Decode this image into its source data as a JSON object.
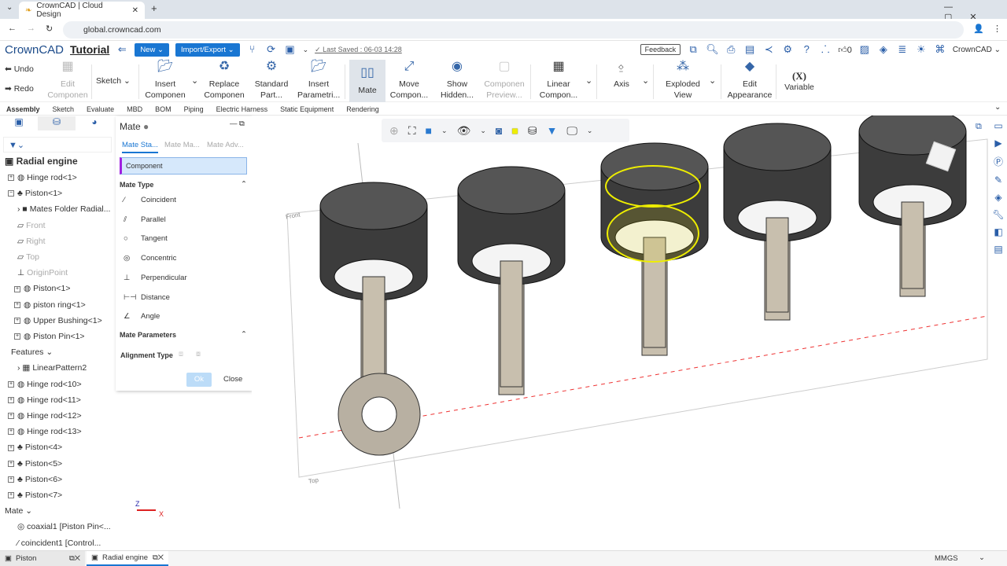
{
  "browser": {
    "tab_title": "CrownCAD | Cloud Design",
    "url": "global.crowncad.com"
  },
  "app": {
    "logo": "CrownCAD",
    "title": "Tutorial",
    "new": "New",
    "import_export": "Import/Export",
    "last_saved": "Last Saved : 06-03 14:28",
    "feedback": "Feedback",
    "likes": "0",
    "user": "CrownCAD"
  },
  "ribbon": {
    "undo": "Undo",
    "redo": "Redo",
    "edit_component": "Edit Componen",
    "sketch": "Sketch",
    "insert_component": "Insert Componen",
    "replace_component": "Replace Componen",
    "standard_part": "Standard Part...",
    "insert_parametric": "Insert Parametri...",
    "mate": "Mate",
    "move_component": "Move Compon...",
    "show_hidden": "Show Hidden...",
    "component_preview": "Componen Preview...",
    "linear_component": "Linear Compon...",
    "axis": "Axis",
    "exploded_view": "Exploded View",
    "edit_appearance": "Edit Appearance",
    "variable_icon": "(X)",
    "variable": "Variable"
  },
  "ribbon_tabs": [
    "Assembly",
    "Sketch",
    "Evaluate",
    "MBD",
    "BOM",
    "Piping",
    "Electric Harness",
    "Static Equipment",
    "Rendering"
  ],
  "tree": {
    "root": "Radial engine",
    "items": [
      {
        "label": "Hinge rod<1>",
        "kind": "part",
        "level": 0,
        "pm": "+"
      },
      {
        "label": "Piston<1>",
        "kind": "asm",
        "level": 0,
        "pm": "-"
      },
      {
        "label": "Mates Folder Radial...",
        "kind": "folder",
        "level": 1
      },
      {
        "label": "Front",
        "kind": "plane",
        "level": 1
      },
      {
        "label": "Right",
        "kind": "plane",
        "level": 1
      },
      {
        "label": "Top",
        "kind": "plane",
        "level": 1
      },
      {
        "label": "OriginPoint",
        "kind": "origin",
        "level": 1
      },
      {
        "label": "Piston<1>",
        "kind": "part",
        "level": 1,
        "pm": "+"
      },
      {
        "label": "piston ring<1>",
        "kind": "part",
        "level": 1,
        "pm": "+"
      },
      {
        "label": "Upper Bushing<1>",
        "kind": "part",
        "level": 1,
        "pm": "+"
      },
      {
        "label": "Piston Pin<1>",
        "kind": "part",
        "level": 1,
        "pm": "+"
      },
      {
        "label": "Features",
        "kind": "section",
        "level": 1
      },
      {
        "label": "LinearPattern2",
        "kind": "pattern",
        "level": 1
      },
      {
        "label": "Hinge rod<10>",
        "kind": "part",
        "level": 0,
        "pm": "+"
      },
      {
        "label": "Hinge rod<11>",
        "kind": "part",
        "level": 0,
        "pm": "+"
      },
      {
        "label": "Hinge rod<12>",
        "kind": "part",
        "level": 0,
        "pm": "+"
      },
      {
        "label": "Hinge rod<13>",
        "kind": "part",
        "level": 0,
        "pm": "+"
      },
      {
        "label": "Piston<4>",
        "kind": "asm",
        "level": 0,
        "pm": "+"
      },
      {
        "label": "Piston<5>",
        "kind": "asm",
        "level": 0,
        "pm": "+"
      },
      {
        "label": "Piston<6>",
        "kind": "asm",
        "level": 0,
        "pm": "+"
      },
      {
        "label": "Piston<7>",
        "kind": "asm",
        "level": 0,
        "pm": "+"
      },
      {
        "label": "Mate",
        "kind": "section",
        "level": -1
      },
      {
        "label": "coaxial1 [Piston Pin<...",
        "kind": "mate-concentric",
        "level": 1
      },
      {
        "label": "coincident1 [Control...",
        "kind": "mate-coincident",
        "level": 1
      }
    ]
  },
  "mate_panel": {
    "title": "Mate",
    "tabs": [
      "Mate Sta...",
      "Mate Ma...",
      "Mate Adv..."
    ],
    "selection": "Component",
    "mate_type_header": "Mate Type",
    "types": [
      "Coincident",
      "Parallel",
      "Tangent",
      "Concentric",
      "Perpendicular",
      "Distance",
      "Angle"
    ],
    "params_header": "Mate Parameters",
    "alignment_type": "Alignment Type",
    "ok": "Ok",
    "close": "Close"
  },
  "viewport": {
    "front_label": "Front",
    "top_label": "Top",
    "axis_x": "X",
    "axis_z": "Z",
    "units": "MMGS"
  },
  "doc_tabs": [
    "Piston",
    "Radial engine"
  ],
  "colors": {
    "accent": "#1976d2",
    "highlight": "#f0e000"
  }
}
